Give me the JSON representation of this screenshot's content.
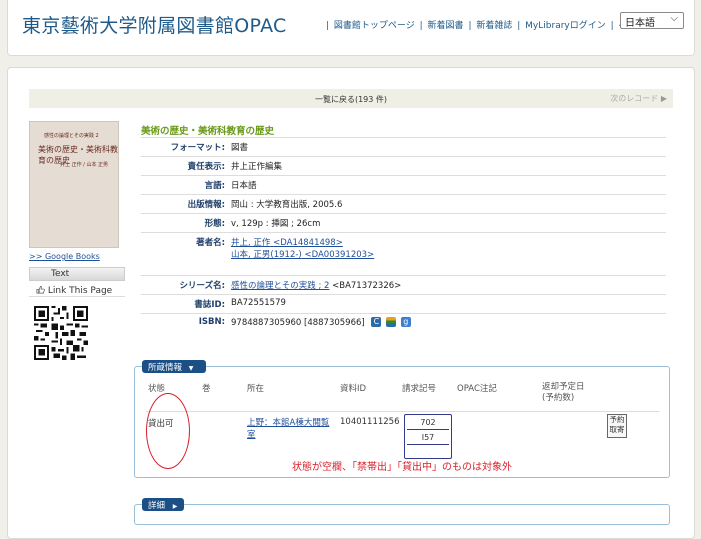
{
  "header": {
    "site_title": "東京藝術大学附属図書館OPAC",
    "nav": [
      "図書館トップページ",
      "新着図書",
      "新着雑誌",
      "MyLibraryログイン",
      "ヘルプ"
    ],
    "language": "日本語"
  },
  "record_nav": {
    "back": "一覧に戻る(193 件)",
    "next": "次のレコード"
  },
  "cover": {
    "series_small": "感性の論理とその実践 2",
    "title_text": "美術の歴史・美術科教育の歴史",
    "authors_small": "井上 正作 / 山本 正男"
  },
  "sidebar": {
    "google_books": ">> Google Books",
    "text_button": "Text",
    "link_this_page": "Link This Page"
  },
  "book": {
    "title": "美術の歴史・美術科教育の歴史",
    "fields": [
      {
        "label": "フォーマット:",
        "value": "図書"
      },
      {
        "label": "責任表示:",
        "value": "井上正作編集"
      },
      {
        "label": "言語:",
        "value": "日本語"
      },
      {
        "label": "出版情報:",
        "value": "岡山 : 大学教育出版, 2005.6"
      },
      {
        "label": "形態:",
        "value": "v, 129p : 挿図 ; 26cm"
      }
    ],
    "authors_label": "著者名:",
    "author1_name": "井上, 正作",
    "author1_id": "<DA14841498>",
    "author2_name": "山本, 正男(1912-)",
    "author2_id": "<DA00391203>",
    "series_label": "シリーズ名:",
    "series_link": "感性の論理とその実践 ; 2",
    "series_id": "<BA71372326>",
    "bibid_label": "書誌ID:",
    "bibid": "BA72551579",
    "isbn_label": "ISBN:",
    "isbn": "9784887305960 [4887305966]"
  },
  "holdings": {
    "tab_label": "所蔵情報",
    "headers": {
      "status": "状態",
      "volume": "巻",
      "location": "所在",
      "material_id": "資料ID",
      "call_number": "請求記号",
      "opac_note": "OPAC注記",
      "due_line1": "返却予定日",
      "due_line2": "(予約数)"
    },
    "row": {
      "status": "貸出可",
      "location_line1": "上野：本館A棟大閲覧",
      "location_line2": "室",
      "material_id": "10401111256",
      "call_number": [
        "702",
        "I57",
        ""
      ],
      "reserve_line1": "予約",
      "reserve_line2": "取寄"
    },
    "annotation": "状態が空欄、「禁帯出」「貸出中」のものは対象外"
  },
  "detail": {
    "tab_label": "詳細"
  },
  "colors": {
    "title_blue": "#1f5b8a",
    "book_title_green": "#6a9a1a",
    "tab_navy": "#1b4f86",
    "annotation_red": "#d9202a"
  }
}
